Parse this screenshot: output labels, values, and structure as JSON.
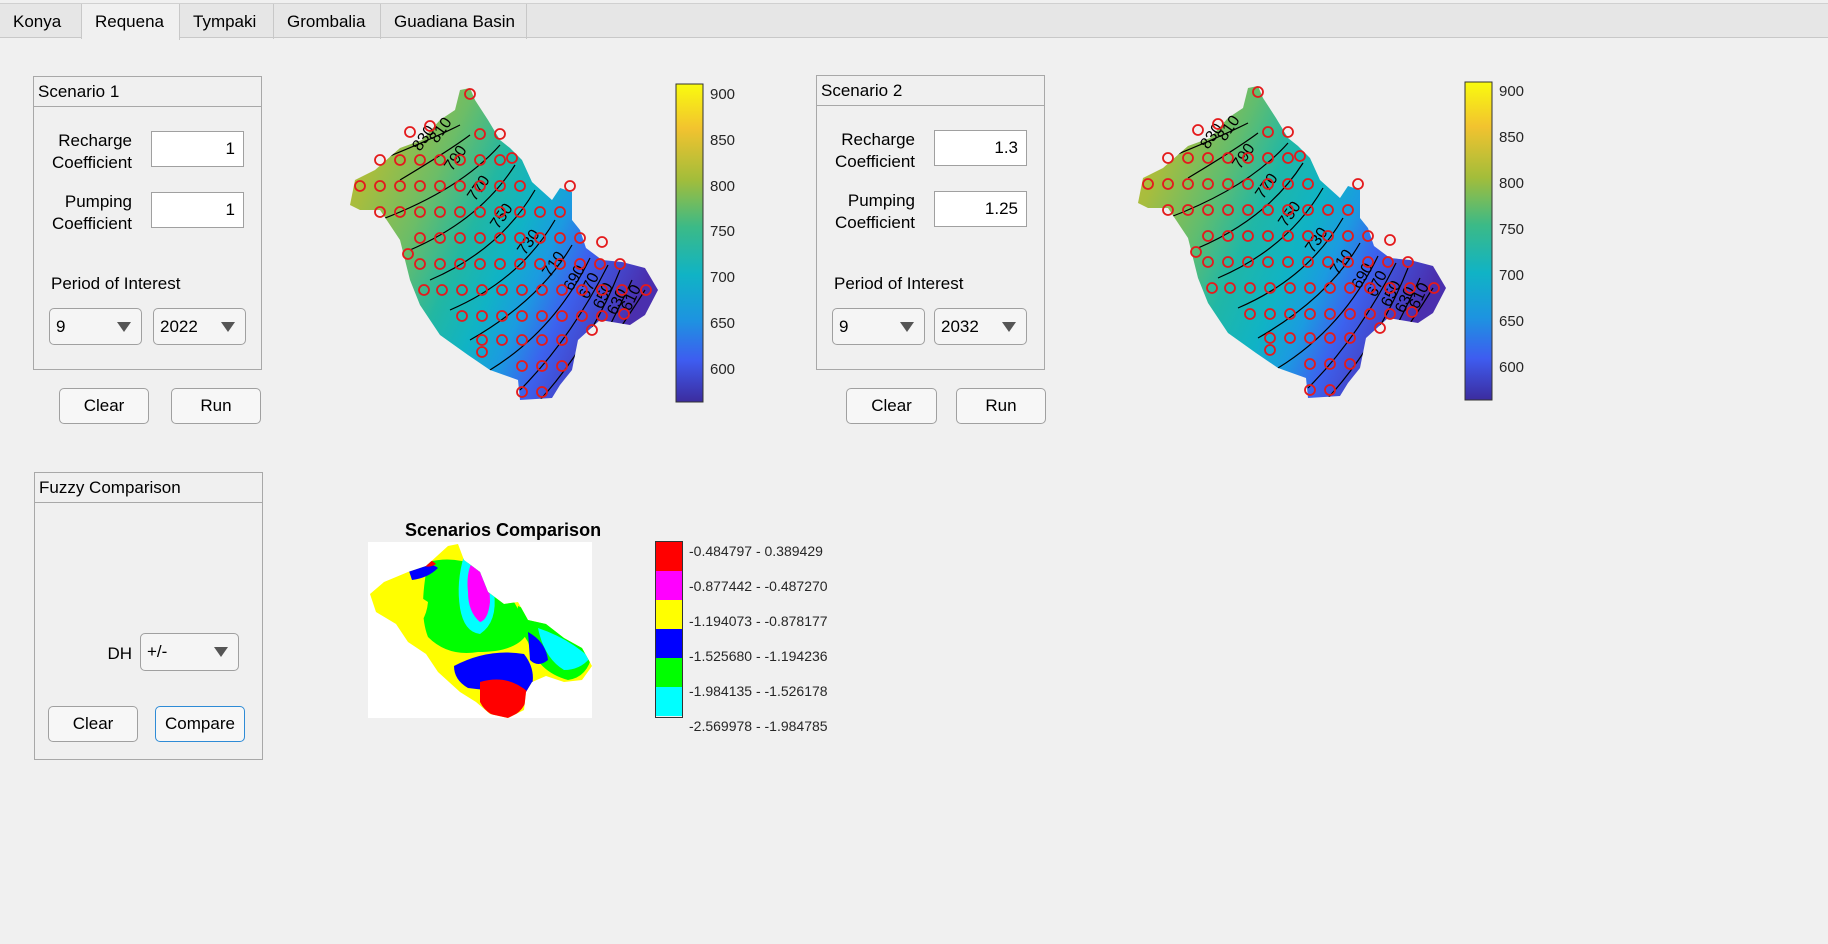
{
  "tabs": [
    {
      "label": "Konya",
      "active": false
    },
    {
      "label": "Requena",
      "active": true
    },
    {
      "label": "Tympaki",
      "active": false
    },
    {
      "label": "Grombalia",
      "active": false
    },
    {
      "label": "Guadiana Basin",
      "active": false
    }
  ],
  "scenario1": {
    "title": "Scenario 1",
    "recharge_label_1": "Recharge",
    "recharge_label_2": "Coefficient",
    "recharge_value": "1",
    "pumping_label_1": "Pumping",
    "pumping_label_2": "Coefficient",
    "pumping_value": "1",
    "period_label": "Period of Interest",
    "month": "9",
    "year": "2022",
    "clear_label": "Clear",
    "run_label": "Run"
  },
  "scenario2": {
    "title": "Scenario 2",
    "recharge_label_1": "Recharge",
    "recharge_label_2": "Coefficient",
    "recharge_value": "1.3",
    "pumping_label_1": "Pumping",
    "pumping_label_2": "Coefficient",
    "pumping_value": "1.25",
    "period_label": "Period of Interest",
    "month": "9",
    "year": "2032",
    "clear_label": "Clear",
    "run_label": "Run"
  },
  "fuzzy": {
    "title": "Fuzzy Comparison",
    "dh_label": "DH",
    "dh_value": "+/-",
    "clear_label": "Clear",
    "compare_label": "Compare"
  },
  "colorbar": {
    "ticks": [
      "900",
      "850",
      "800",
      "750",
      "700",
      "650",
      "600"
    ],
    "colors": [
      "#f9fb0e",
      "#f2c32f",
      "#a3bd3a",
      "#3bba87",
      "#10b3c5",
      "#1d94e0",
      "#3e5cf0",
      "#3c2c9e"
    ]
  },
  "contour_labels_1": [
    "830",
    "810",
    "790",
    "770",
    "750",
    "730",
    "710",
    "690",
    "670",
    "650",
    "630",
    "610"
  ],
  "contour_labels_2": [
    "830",
    "810",
    "790",
    "770",
    "750",
    "730",
    "710",
    "690",
    "670",
    "650",
    "630",
    "610"
  ],
  "comparison": {
    "title": "Scenarios Comparison",
    "legend": [
      {
        "label": "-0.484797 - 0.389429",
        "color": "#ff0000"
      },
      {
        "label": "-0.877442 - -0.487270",
        "color": "#ff00ff"
      },
      {
        "label": "-1.194073 - -0.878177",
        "color": "#ffff00"
      },
      {
        "label": "-1.525680 - -1.194236",
        "color": "#0000ff"
      },
      {
        "label": "-1.984135 - -1.526178",
        "color": "#00ff00"
      },
      {
        "label": "-2.569978 - -1.984785",
        "color": "#00ffff"
      }
    ]
  }
}
